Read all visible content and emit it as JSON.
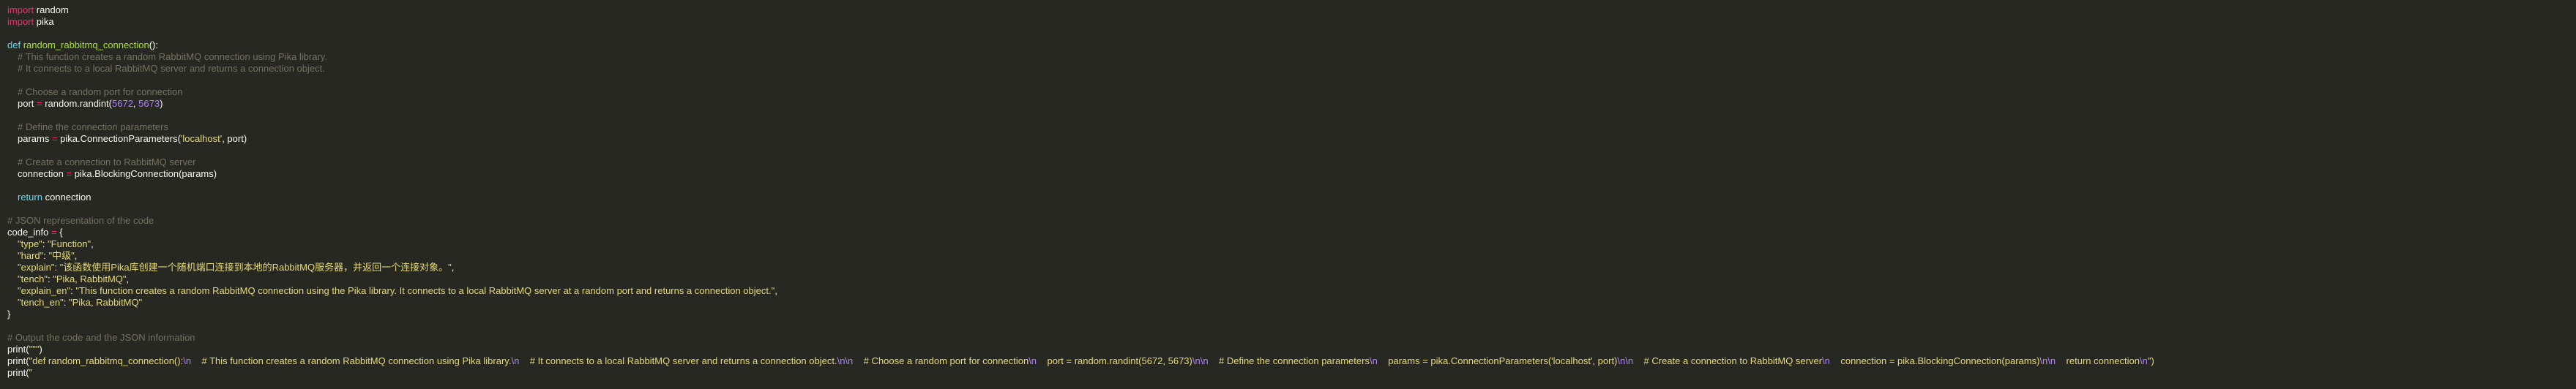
{
  "code": {
    "l1": {
      "kw": "import",
      "rest": " random"
    },
    "l2": {
      "kw": "import",
      "rest": " pika"
    },
    "l4": {
      "kw": "def",
      "name": "random_rabbitmq_connection",
      "rest": "():"
    },
    "l5": "# This function creates a random RabbitMQ connection using Pika library.",
    "l6": "# It connects to a local RabbitMQ server and returns a connection object.",
    "l8": "# Choose a random port for connection",
    "l9": {
      "a": "port ",
      "op": "=",
      "b": " random.randint(",
      "n1": "5672",
      "c": ", ",
      "n2": "5673",
      "d": ")"
    },
    "l11": "# Define the connection parameters",
    "l12": {
      "a": "params ",
      "op": "=",
      "b": " pika.ConnectionParameters(",
      "s": "'localhost'",
      "c": ", port)"
    },
    "l14": "# Create a connection to RabbitMQ server",
    "l15": {
      "a": "connection ",
      "op": "=",
      "b": " pika.BlockingConnection(params)"
    },
    "l17": {
      "kw": "return",
      "rest": " connection"
    },
    "l19": "# JSON representation of the code",
    "l20": {
      "a": "code_info ",
      "op": "=",
      "b": " {"
    },
    "l21": {
      "k": "\"type\"",
      "c": ": ",
      "v": "\"Function\"",
      "e": ","
    },
    "l22": {
      "k": "\"hard\"",
      "c": ": ",
      "v": "\"中级\"",
      "e": ","
    },
    "l23": {
      "k": "\"explain\"",
      "c": ": ",
      "v": "\"该函数使用Pika库创建一个随机端口连接到本地的RabbitMQ服务器，并返回一个连接对象。\"",
      "e": ","
    },
    "l24": {
      "k": "\"tench\"",
      "c": ": ",
      "v": "\"Pika, RabbitMQ\"",
      "e": ","
    },
    "l25": {
      "k": "\"explain_en\"",
      "c": ": ",
      "v": "\"This function creates a random RabbitMQ connection using the Pika library. It connects to a local RabbitMQ server at a random port and returns a connection object.\"",
      "e": ","
    },
    "l26": {
      "k": "\"tench_en\"",
      "c": ": ",
      "v": "\"Pika, RabbitMQ\"",
      "e": ""
    },
    "l27": "}",
    "l29": "# Output the code and the JSON information",
    "l30": {
      "a": "print(",
      "s": "\"\"\"",
      "b": ")"
    },
    "l31": {
      "a": "print(",
      "s1": "\"def random_rabbitmq_connection():",
      "e1": "\\n",
      "s2": "    # This function creates a random RabbitMQ connection using Pika library.",
      "e2": "\\n",
      "s3": "    # It connects to a local RabbitMQ server and returns a connection object.",
      "e3": "\\n\\n",
      "s4": "    # Choose a random port for connection",
      "e4": "\\n",
      "s5": "    port = random.randint(5672, 5673)",
      "e5": "\\n\\n",
      "s6": "    # Define the connection parameters",
      "e6": "\\n",
      "s7": "    params = pika.ConnectionParameters('localhost', port)",
      "e7": "\\n\\n",
      "s8": "    # Create a connection to RabbitMQ server",
      "e8": "\\n",
      "s9": "    connection = pika.BlockingConnection(params)",
      "e9": "\\n\\n",
      "s10": "    return connection",
      "e10": "\\n",
      "s11": "\")"
    },
    "l32": {
      "a": "print(",
      "s": "\""
    }
  },
  "colors": {
    "background": "#272822",
    "keyword": "#f92672",
    "function": "#a6e22e",
    "comment": "#75715e",
    "string": "#e6db74",
    "number": "#ae81ff"
  }
}
